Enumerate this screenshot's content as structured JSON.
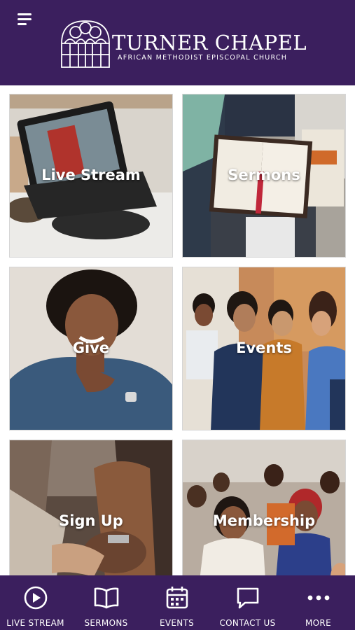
{
  "header": {
    "title": "Turner Chapel",
    "subtitle": "African Methodist Episcopal Church",
    "bg_color": "#3b1f5e"
  },
  "tiles": [
    {
      "label": "Live Stream",
      "icon": "laptop-photo"
    },
    {
      "label": "Sermons",
      "icon": "bible-photo"
    },
    {
      "label": "Give",
      "icon": "woman-smiling-photo"
    },
    {
      "label": "Events",
      "icon": "group-laughing-photo"
    },
    {
      "label": "Sign Up",
      "icon": "holding-hands-photo"
    },
    {
      "label": "Membership",
      "icon": "congregation-photo"
    }
  ],
  "tabbar": {
    "items": [
      {
        "label": "LIVE STREAM",
        "icon": "play-circle-icon"
      },
      {
        "label": "SERMONS",
        "icon": "book-open-icon"
      },
      {
        "label": "EVENTS",
        "icon": "calendar-icon"
      },
      {
        "label": "CONTACT US",
        "icon": "chat-bubble-icon"
      },
      {
        "label": "MORE",
        "icon": "more-dots-icon"
      }
    ]
  }
}
